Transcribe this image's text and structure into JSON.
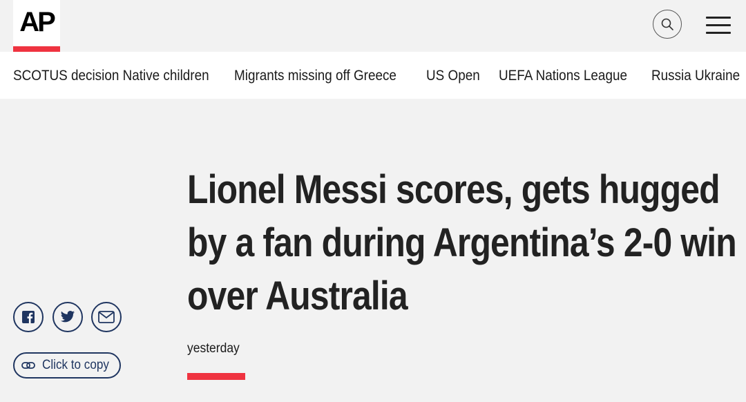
{
  "header": {
    "logo_text": "AP",
    "search_icon": "search-icon",
    "menu_icon": "hamburger-menu-icon",
    "accent_color": "#ef3340"
  },
  "nav": {
    "items": [
      {
        "label": "SCOTUS decision Native children"
      },
      {
        "label": "Migrants missing off Greece"
      },
      {
        "label": "US Open"
      },
      {
        "label": "UEFA Nations League"
      },
      {
        "label": "Russia Ukraine"
      }
    ]
  },
  "article": {
    "headline_lines": [
      "Lionel Messi scores, gets hugged",
      "by a fan during Argentina’s 2-0 win",
      "over Australia"
    ],
    "timestamp": "yesterday"
  },
  "share": {
    "facebook_icon": "facebook-icon",
    "twitter_icon": "twitter-icon",
    "email_icon": "email-icon",
    "copy_icon": "link-icon",
    "copy_label": "Click to copy",
    "button_color": "#1f3560"
  }
}
